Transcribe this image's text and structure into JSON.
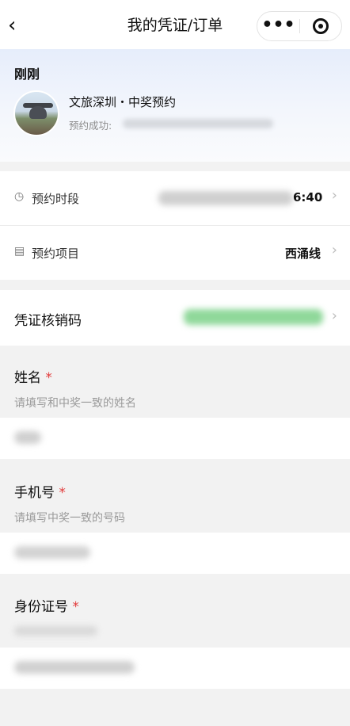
{
  "nav": {
    "back_icon": "chevron-left-icon",
    "back_glyph": "‹",
    "title": "我的凭证/订单",
    "more_glyph": "•••",
    "more_icon": "more-icon",
    "target_icon": "target-icon"
  },
  "notice": {
    "time": "刚刚",
    "name": "文旅深圳・中奖预约",
    "sub": "预约成功:"
  },
  "details": {
    "time_slot_label": "预约时段",
    "time_slot_value": "6:40",
    "time_slot_icon": "clock-icon",
    "project_label": "预约项目",
    "project_value": "西涌线",
    "project_icon": "document-icon",
    "chevron_glyph": "›"
  },
  "voucher": {
    "label": "凭证核销码",
    "accent_color": "#5cc86e"
  },
  "form": {
    "required_mark": "*",
    "fields": [
      {
        "title": "姓名",
        "hint": "请填写和中奖一致的姓名"
      },
      {
        "title": "手机号",
        "hint": "请填写中奖一致的号码"
      },
      {
        "title": "身份证号",
        "hint": ""
      }
    ]
  }
}
